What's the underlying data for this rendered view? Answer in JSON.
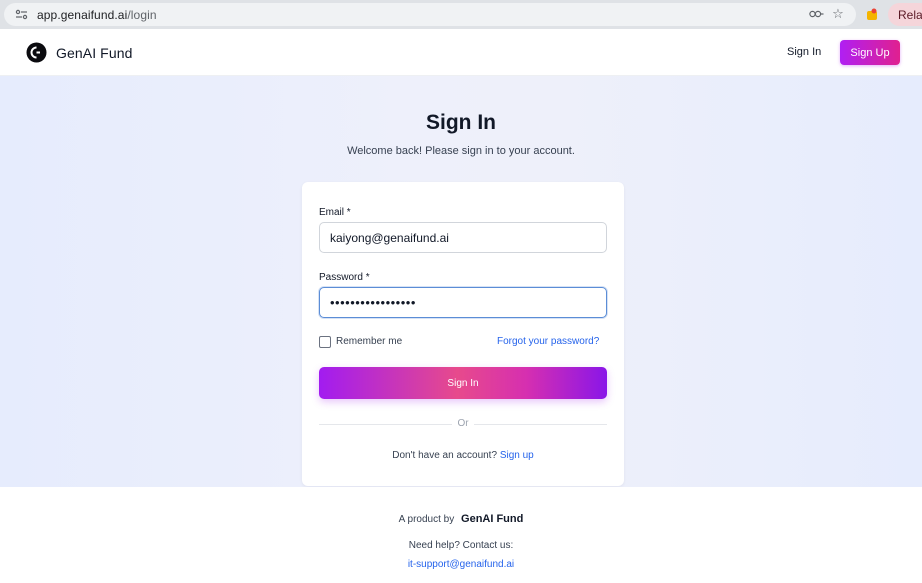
{
  "browser": {
    "url_host": "app.genaifund.ai",
    "url_path": "/login",
    "relaunch_label": "Relau",
    "icons": [
      "site-info-icon",
      "password-key-icon",
      "bookmark-star-icon",
      "extension-icon"
    ]
  },
  "header": {
    "brand": "GenAI Fund",
    "signin_label": "Sign In",
    "signup_label": "Sign Up"
  },
  "page": {
    "title": "Sign In",
    "subtitle": "Welcome back! Please sign in to your account."
  },
  "form": {
    "email_label": "Email",
    "email_value": "kaiyong@genaifund.ai",
    "password_label": "Password",
    "password_value": "•••••••••••••••••",
    "required_mark": "*",
    "remember_label": "Remember me",
    "forgot_label": "Forgot your password?",
    "submit_label": "Sign In",
    "divider_label": "Or",
    "no_account_text": "Don't have an account?",
    "signup_link": "Sign up"
  },
  "footer": {
    "product_by": "A product by",
    "brand": "GenAI Fund",
    "help_text": "Need help? Contact us:",
    "support_email": "it-support@genaifund.ai"
  },
  "colors": {
    "accent_gradient_start": "#a21cf0",
    "accent_gradient_end": "#e0208f",
    "link": "#2563eb",
    "hero_background": "#eaeefc"
  }
}
